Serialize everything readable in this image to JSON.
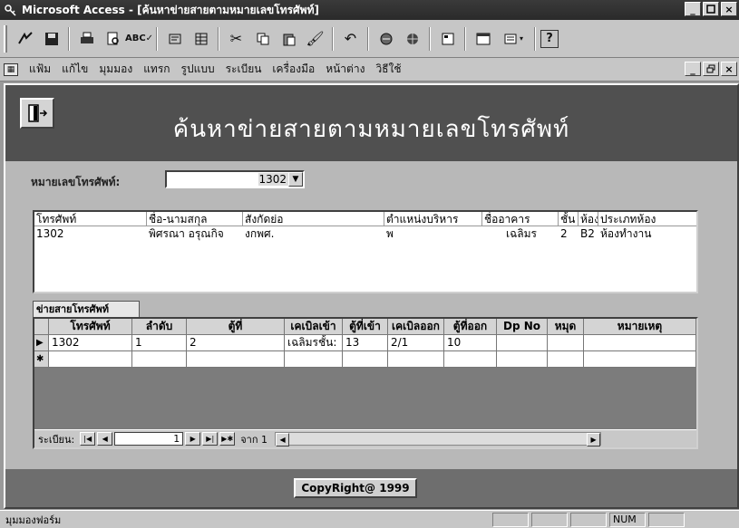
{
  "window": {
    "title": "Microsoft Access - [ค้นหาข่ายสายตามหมายเลขโทรศัพท์]",
    "min": "_",
    "max": "ɑ",
    "close": "×"
  },
  "menu": {
    "items": [
      "แฟ้ม",
      "แก้ไข",
      "มุมมอง",
      "แทรก",
      "รูปแบบ",
      "ระเบียน",
      "เครื่องมือ",
      "หน้าต่าง",
      "วิธีใช้"
    ]
  },
  "form": {
    "title": "ค้นหาข่ายสายตามหมายเลขโทรศัพท์",
    "phone_label": "หมายเลขโทรศัพท์:",
    "phone_value": "1302",
    "copyright": "CopyRight@ 1999"
  },
  "listbox": {
    "headers": [
      "โทรศัพท์",
      "ชื่อ-นามสกุล",
      "สังกัดย่อ",
      "ตำแหน่งบริหาร",
      "ชื่ออาคาร",
      "ชั้น",
      "ห้อง",
      "ประเภทห้อง"
    ],
    "rows": [
      [
        "1302",
        "พิศรณา  อรุณกิจ",
        "งกพศ.",
        "พ",
        "เฉลิมร",
        "2",
        "B2",
        "ห้องทำงาน"
      ]
    ]
  },
  "subform": {
    "tab_label": "ข่ายสายโทรศัพท์",
    "headers": [
      "โทรศัพท์",
      "ลำดับ",
      "ตู้ที่",
      "เคเบิลเข้า",
      "ตู้ที่เข้า",
      "เคเบิลออก",
      "ตู้ที่ออก",
      "Dp No",
      "หมุด",
      "หมายเหตุ"
    ],
    "rows": [
      [
        "1302",
        "1",
        "2",
        "เฉลิมรชั้น:",
        "13",
        "2/1",
        "10",
        "",
        "",
        ""
      ]
    ],
    "nav": {
      "label": "ระเบียน:",
      "current": "1",
      "of_label": "จาก 1"
    }
  },
  "status": {
    "text": "มุมมองฟอร์ม",
    "num": "NUM"
  }
}
